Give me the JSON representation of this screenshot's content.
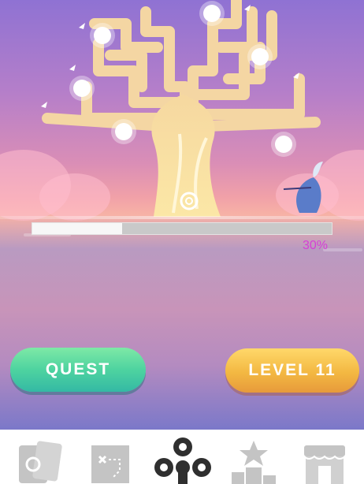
{
  "progress": {
    "value": 0.3,
    "label": "30%"
  },
  "buttons": {
    "quest": "QUEST",
    "level": "LEVEL 11"
  },
  "nav": {
    "items": [
      {
        "name": "cards",
        "icon": "cards-icon",
        "active": false
      },
      {
        "name": "map",
        "icon": "treasure-map-icon",
        "active": false
      },
      {
        "name": "tree",
        "icon": "tree-nodes-icon",
        "active": true
      },
      {
        "name": "leaderboard",
        "icon": "podium-star-icon",
        "active": false
      },
      {
        "name": "shop",
        "icon": "shop-icon",
        "active": false
      }
    ]
  },
  "colors": {
    "inactive_icon": "#c4c4c4",
    "active_icon": "#2f2f2f",
    "percent_text": "#d63fd6",
    "quest_button": "#4ed3a0",
    "level_button": "#f3b842"
  }
}
